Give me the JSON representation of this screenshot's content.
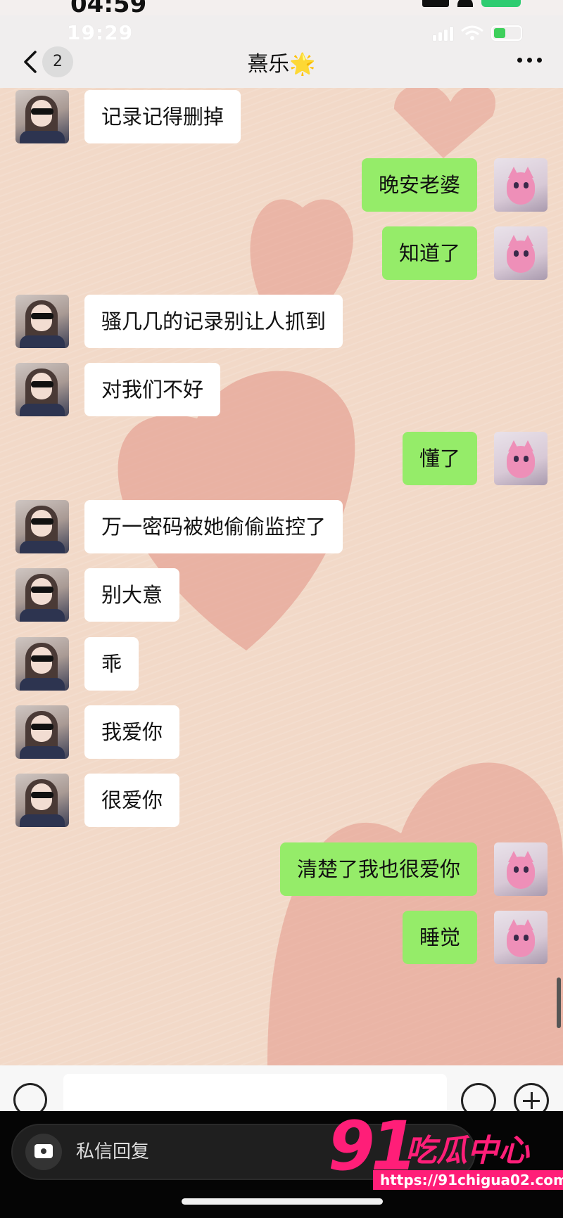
{
  "outer_status": {
    "time": "04:59"
  },
  "status_bar": {
    "time": "19:29"
  },
  "header": {
    "back_badge": "2",
    "contact_name": "熹乐",
    "title_emoji": "🌟"
  },
  "messages": [
    {
      "side": "in",
      "text": "记录记得删掉"
    },
    {
      "side": "out",
      "text": "晚安老婆"
    },
    {
      "side": "out",
      "text": "知道了"
    },
    {
      "side": "in",
      "text": "骚几几的记录别让人抓到"
    },
    {
      "side": "in",
      "text": "对我们不好"
    },
    {
      "side": "out",
      "text": "懂了"
    },
    {
      "side": "in",
      "text": "万一密码被她偷偷监控了"
    },
    {
      "side": "in",
      "text": "别大意"
    },
    {
      "side": "in",
      "text": "乖"
    },
    {
      "side": "in",
      "text": "我爱你"
    },
    {
      "side": "in",
      "text": "很爱你"
    },
    {
      "side": "out",
      "text": "清楚了我也很爱你"
    },
    {
      "side": "out",
      "text": "睡觉"
    }
  ],
  "outer_bar": {
    "reply_placeholder": "私信回复"
  },
  "watermark": {
    "number": "91",
    "text": "吃瓜中心",
    "url": "https://91chigua02.com"
  },
  "colors": {
    "bubble_out": "#95ec69",
    "bubble_in": "#ffffff",
    "chat_bg": "#f2d9c8",
    "heart": "#e3988a",
    "watermark": "#ff1e78"
  }
}
